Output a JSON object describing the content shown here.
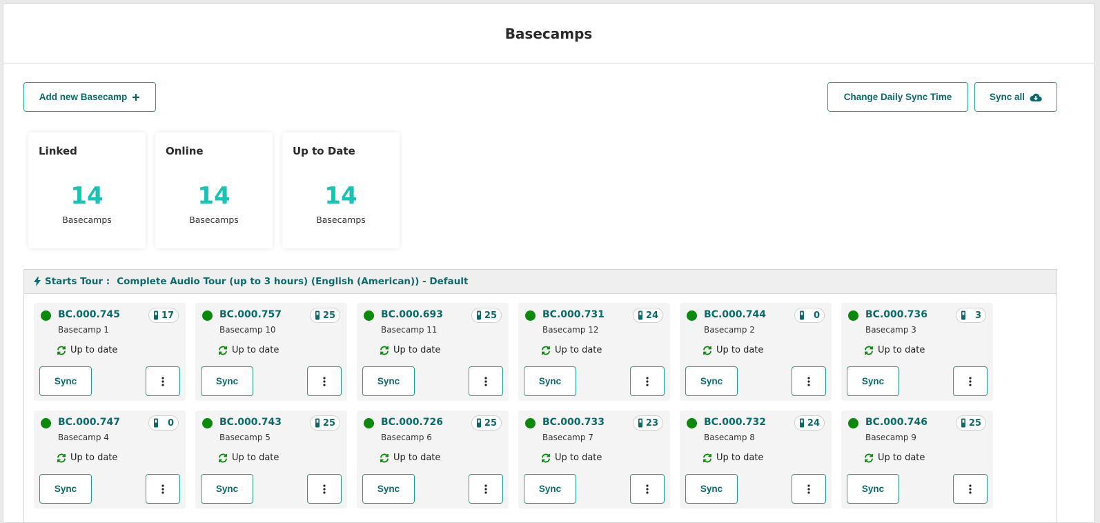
{
  "header": {
    "title": "Basecamps"
  },
  "toolbar": {
    "add_label": "Add new Basecamp",
    "change_label": "Change Daily Sync Time",
    "sync_all_label": "Sync all"
  },
  "stats": [
    {
      "label": "Linked",
      "value": "14",
      "unit": "Basecamps"
    },
    {
      "label": "Online",
      "value": "14",
      "unit": "Basecamps"
    },
    {
      "label": "Up to Date",
      "value": "14",
      "unit": "Basecamps"
    }
  ],
  "tour": {
    "prefix": "Starts Tour :",
    "name": "Complete Audio Tour (up to 3 hours) (English (American)) - Default"
  },
  "basecamps": [
    {
      "code": "BC.000.745",
      "name": "Basecamp 1",
      "count": "17",
      "status": "Up to date",
      "sync_label": "Sync"
    },
    {
      "code": "BC.000.757",
      "name": "Basecamp 10",
      "count": "25",
      "status": "Up to date",
      "sync_label": "Sync"
    },
    {
      "code": "BC.000.693",
      "name": "Basecamp 11",
      "count": "25",
      "status": "Up to date",
      "sync_label": "Sync"
    },
    {
      "code": "BC.000.731",
      "name": "Basecamp 12",
      "count": "24",
      "status": "Up to date",
      "sync_label": "Sync"
    },
    {
      "code": "BC.000.744",
      "name": "Basecamp 2",
      "count": "0",
      "status": "Up to date",
      "sync_label": "Sync"
    },
    {
      "code": "BC.000.736",
      "name": "Basecamp 3",
      "count": "3",
      "status": "Up to date",
      "sync_label": "Sync"
    },
    {
      "code": "BC.000.747",
      "name": "Basecamp 4",
      "count": "0",
      "status": "Up to date",
      "sync_label": "Sync"
    },
    {
      "code": "BC.000.743",
      "name": "Basecamp 5",
      "count": "25",
      "status": "Up to date",
      "sync_label": "Sync"
    },
    {
      "code": "BC.000.726",
      "name": "Basecamp 6",
      "count": "25",
      "status": "Up to date",
      "sync_label": "Sync"
    },
    {
      "code": "BC.000.733",
      "name": "Basecamp 7",
      "count": "23",
      "status": "Up to date",
      "sync_label": "Sync"
    },
    {
      "code": "BC.000.732",
      "name": "Basecamp 8",
      "count": "24",
      "status": "Up to date",
      "sync_label": "Sync"
    },
    {
      "code": "BC.000.746",
      "name": "Basecamp 9",
      "count": "25",
      "status": "Up to date",
      "sync_label": "Sync"
    }
  ],
  "colors": {
    "accent": "#18a39a",
    "text_teal": "#0b6b6b",
    "stat": "#17c3b2",
    "online": "#0a8a0a"
  },
  "icons": {
    "add": "plus-icon",
    "sync_all": "cloud-download-icon",
    "tour": "lightning-icon",
    "device": "device-icon",
    "status": "refresh-icon",
    "more": "more-vertical-icon"
  }
}
